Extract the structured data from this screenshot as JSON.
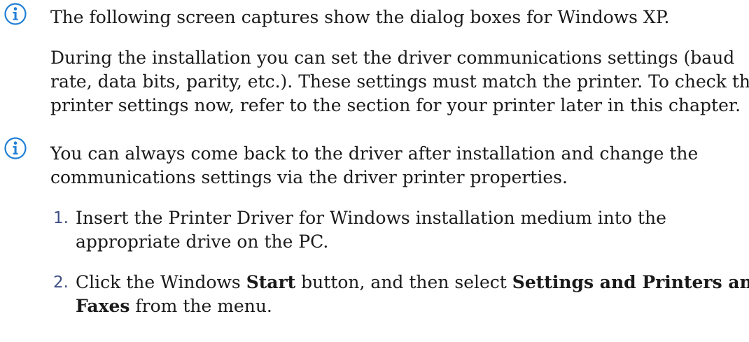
{
  "note1": {
    "text": "The following screen captures show the dialog boxes for Windows XP."
  },
  "para": {
    "line1": "During the installation you can set the driver communications settings (baud",
    "line2": "rate, data bits, parity, etc.). These settings must match the printer. To check the",
    "line3": "printer settings now, refer to the section for your printer later in this chapter."
  },
  "note2": {
    "line1": "You can always come back to the driver after installation and change the",
    "line2": "communications settings via the driver printer properties."
  },
  "steps": [
    {
      "number": "1.",
      "line1": "Insert the Printer Driver for Windows installation medium into the",
      "line2": "appropriate drive on the PC."
    },
    {
      "number": "2.",
      "line1_a": "Click the Windows ",
      "line1_b": "Start",
      "line1_c": " button, and then select ",
      "line1_d": "Settings and Printers and",
      "line2_a": "Faxes",
      "line2_b": " from the menu."
    }
  ],
  "icons": {
    "note_icon": "info-circle-icon",
    "color": "#1f7fd6"
  }
}
